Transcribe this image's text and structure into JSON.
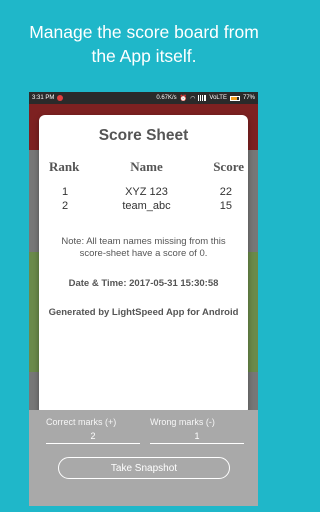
{
  "promo": {
    "line1": "Manage the score board from",
    "line2": "the App itself."
  },
  "status_bar": {
    "time": "3:31 PM",
    "network_speed": "0.67K/s",
    "carrier": "VoLTE",
    "battery": "77%"
  },
  "dialog": {
    "title": "Score Sheet",
    "headers": {
      "rank": "Rank",
      "name": "Name",
      "score": "Score"
    },
    "rows": [
      {
        "rank": "1",
        "name": "XYZ 123",
        "score": "22"
      },
      {
        "rank": "2",
        "name": "team_abc",
        "score": "15"
      }
    ],
    "note": "Note: All team names missing from this score-sheet have a score of 0.",
    "datetime": "Date & Time: 2017-05-31 15:30:58",
    "generated_by": "Generated by LightSpeed App for Android"
  },
  "bottom": {
    "correct_label": "Correct marks (+)",
    "correct_value": "2",
    "wrong_label": "Wrong marks (-)",
    "wrong_value": "1",
    "snapshot_label": "Take Snapshot"
  },
  "colors": {
    "background": "#1fb7c9",
    "app_bar": "#7d2121",
    "bottom_panel": "#a9a9a9"
  }
}
